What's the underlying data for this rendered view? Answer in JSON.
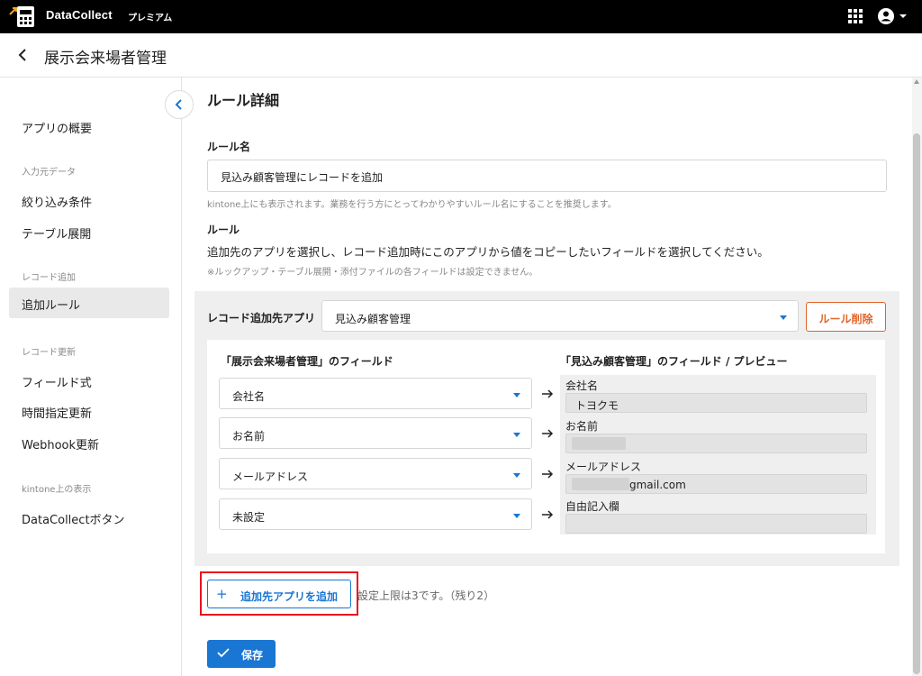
{
  "app": {
    "brand": "DataCollect",
    "plan": "プレミアム"
  },
  "header": {
    "page_title": "展示会来場者管理"
  },
  "sidebar": {
    "items": [
      {
        "type": "item",
        "label": "アプリの概要"
      },
      {
        "type": "section",
        "label": "入力元データ"
      },
      {
        "type": "item",
        "label": "絞り込み条件"
      },
      {
        "type": "item",
        "label": "テーブル展開"
      },
      {
        "type": "section",
        "label": "レコード追加"
      },
      {
        "type": "item",
        "label": "追加ルール",
        "active": true
      },
      {
        "type": "section",
        "label": "レコード更新"
      },
      {
        "type": "item",
        "label": "フィールド式"
      },
      {
        "type": "item",
        "label": "時間指定更新"
      },
      {
        "type": "item",
        "label": "Webhook更新"
      },
      {
        "type": "section",
        "label": "kintone上の表示"
      },
      {
        "type": "item",
        "label": "DataCollectボタン"
      }
    ]
  },
  "main": {
    "title": "ルール詳細",
    "rule_name_label": "ルール名",
    "rule_name_value": "見込み顧客管理にレコードを追加",
    "rule_name_hint": "kintone上にも表示されます。業務を行う方にとってわかりやすいルール名にすることを推奨します。",
    "rule_label": "ルール",
    "rule_desc": "追加先のアプリを選択し、レコード追加時にこのアプリから値をコピーしたいフィールドを選択してください。",
    "rule_note": "※ルックアップ・テーブル展開・添付ファイルの各フィールドは設定できません。",
    "target_app_label": "レコード追加先アプリ",
    "target_app_value": "見込み顧客管理",
    "delete_rule_label": "ルール削除",
    "source_header": "「展示会来場者管理」のフィールド",
    "target_header": "「見込み顧客管理」のフィールド / プレビュー",
    "mappings": [
      {
        "source": "会社名",
        "target": "会社名",
        "preview": "トヨクモ"
      },
      {
        "source": "お名前",
        "target": "お名前",
        "preview": ""
      },
      {
        "source": "メールアドレス",
        "target": "メールアドレス",
        "preview": "gmail.com"
      },
      {
        "source": "未設定",
        "target": "自由記入欄",
        "preview": ""
      }
    ],
    "add_target_label": "追加先アプリを追加",
    "limit_text": "設定上限は3です。（残り2）",
    "save_label": "保存"
  },
  "colors": {
    "accent": "#1976d2",
    "danger": "#e0662b",
    "highlight": "#e8121d"
  }
}
